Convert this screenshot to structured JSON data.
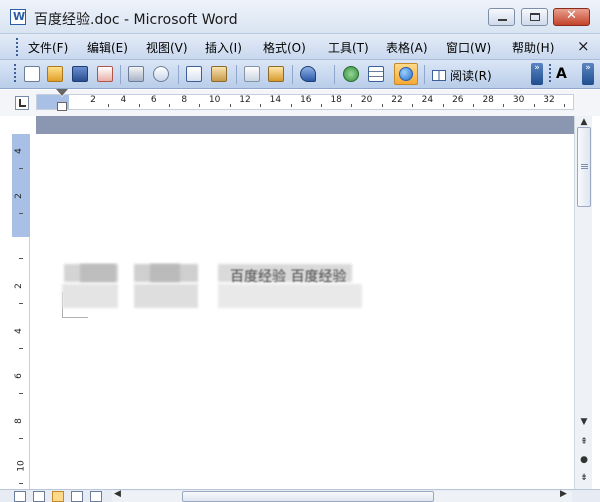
{
  "window": {
    "title": "百度经验.doc - Microsoft Word",
    "minimize_label": "–",
    "maximize_label": "□",
    "close_label": "✕"
  },
  "menu": {
    "items": [
      {
        "label": "文件(F)"
      },
      {
        "label": "编辑(E)"
      },
      {
        "label": "视图(V)"
      },
      {
        "label": "插入(I)"
      },
      {
        "label": "格式(O)"
      },
      {
        "label": "工具(T)"
      },
      {
        "label": "表格(A)"
      },
      {
        "label": "窗口(W)"
      },
      {
        "label": "帮助(H)"
      }
    ],
    "close_doc_label": "×"
  },
  "toolbar": {
    "icons": [
      "new-document-icon",
      "open-folder-icon",
      "save-icon",
      "permission-icon",
      "print-icon",
      "print-preview-icon",
      "spelling-icon",
      "research-icon",
      "copy-icon",
      "paste-icon",
      "undo-icon",
      "hyperlink-icon",
      "table-icon",
      "document-map-icon"
    ],
    "read_label": "阅读(R)",
    "font_size_label": "A",
    "overflow_label": "»"
  },
  "ruler": {
    "horizontal_labels": [
      "2",
      "4",
      "6",
      "8",
      "10",
      "12",
      "14",
      "16",
      "18",
      "20",
      "22",
      "24",
      "26",
      "28",
      "30",
      "32"
    ],
    "vertical_labels": [
      "4",
      "2",
      "",
      "2",
      "4",
      "6",
      "8",
      "10"
    ]
  },
  "document": {
    "visible_text": "百度经验 百度经验"
  },
  "colors": {
    "accent": "#2b5ea8",
    "toolbar": "#c9d8ee",
    "active_toggle": "#f7a935"
  }
}
